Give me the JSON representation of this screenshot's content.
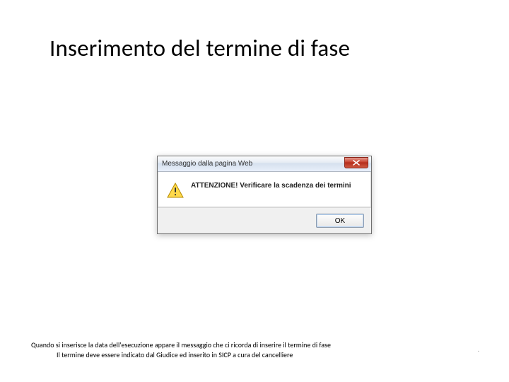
{
  "slide": {
    "title": "Inserimento del termine di fase"
  },
  "dialog": {
    "titlebar": "Messaggio dalla pagina Web",
    "message": "ATTENZIONE! Verificare la scadenza dei termini",
    "ok_label": "OK"
  },
  "caption": {
    "line1": "Quando si inserisce la data dell'esecuzione appare il messaggio che ci ricorda di inserire il termine di fase",
    "line2": "Il termine deve essere indicato dal Giudice ed inserito in SICP a cura del cancelliere"
  },
  "page_indicator": "."
}
